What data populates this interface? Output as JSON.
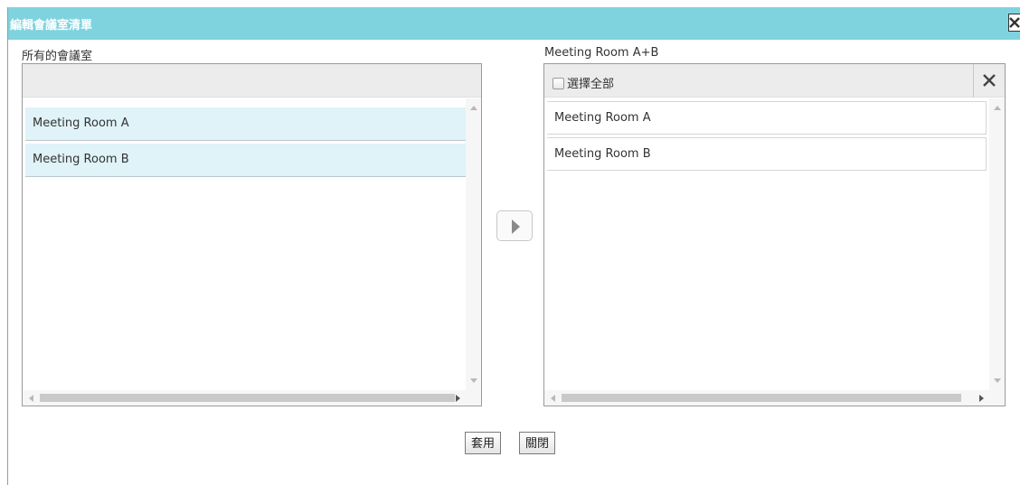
{
  "dialog": {
    "title": "編輯會議室清單"
  },
  "left": {
    "label": "所有的會議室",
    "items": [
      {
        "label": "Meeting Room A"
      },
      {
        "label": "Meeting Room B"
      }
    ]
  },
  "right": {
    "label": "Meeting Room A+B",
    "select_all_label": "選擇全部",
    "items": [
      {
        "label": "Meeting Room A"
      },
      {
        "label": "Meeting Room B"
      }
    ]
  },
  "footer": {
    "apply_label": "套用",
    "close_label": "關閉"
  },
  "colors": {
    "titlebar": "#7fd3df",
    "selected_item": "#dff3f8"
  },
  "icons": {
    "dialog_close": "close-icon",
    "move": "move-right-icon",
    "clear": "clear-icon"
  }
}
